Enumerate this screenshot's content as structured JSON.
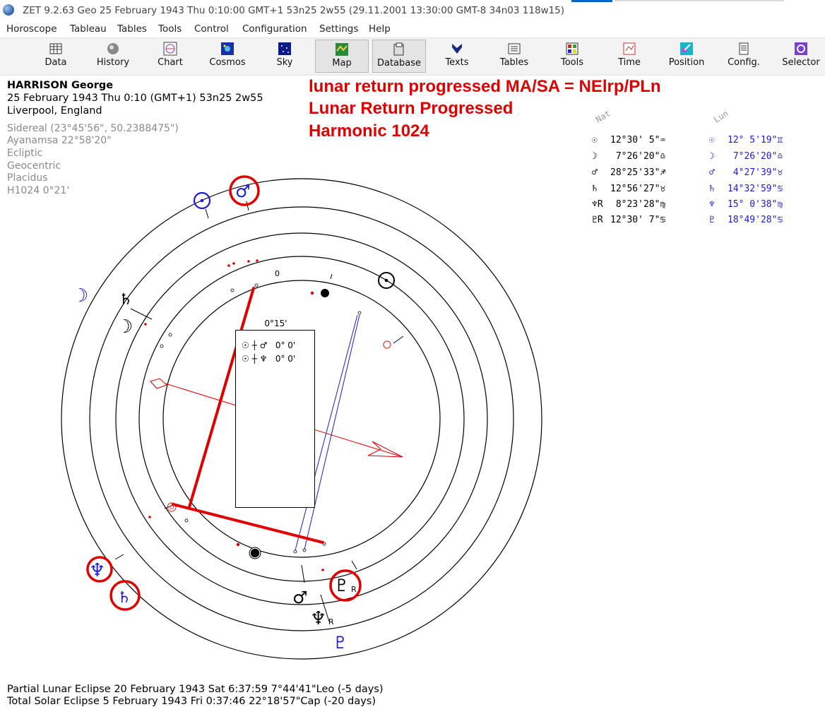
{
  "window": {
    "title": "ZET 9.2.63 Geo   25 February 1943  Thu   0:10:00 GMT+1 53n25  2w55   (29.11.2001  13:30:00 GMT-8 34n03 118w15)"
  },
  "menu": [
    "Horoscope",
    "Tableau",
    "Tables",
    "Tools",
    "Control",
    "Configuration",
    "Settings",
    "Help"
  ],
  "toolbar": [
    {
      "label": "Data",
      "icon": "data-grid-icon"
    },
    {
      "label": "History",
      "icon": "history-icon"
    },
    {
      "label": "Chart",
      "icon": "chart-wheel-icon"
    },
    {
      "label": "Cosmos",
      "icon": "cosmos-icon"
    },
    {
      "label": "Sky",
      "icon": "sky-icon"
    },
    {
      "label": "Map",
      "icon": "map-icon",
      "pressed": true
    },
    {
      "label": "Database",
      "icon": "database-icon",
      "pressed": true
    },
    {
      "label": "Texts",
      "icon": "texts-icon"
    },
    {
      "label": "Tables",
      "icon": "tables-icon"
    },
    {
      "label": "Tools",
      "icon": "tools-icon"
    },
    {
      "label": "Time",
      "icon": "time-icon"
    },
    {
      "label": "Position",
      "icon": "position-icon"
    },
    {
      "label": "Config.",
      "icon": "config-icon"
    },
    {
      "label": "Selector",
      "icon": "selector-icon"
    }
  ],
  "person": {
    "name": "HARRISON George",
    "birth": "25 February 1943  Thu   0:10 (GMT+1) 53n25  2w55",
    "place": "Liverpool, England"
  },
  "settings_lines": [
    "Sidereal (23°45'56\", 50.2388475\")",
    "Ayanamsa 22°58'20\"",
    "Ecliptic",
    "Geocentric",
    "Placidus",
    "H1024   0°21'"
  ],
  "annotation": {
    "line1": "lunar return progressed MA/SA = NElrp/PLn",
    "line2": "Lunar Return Progressed",
    "line3": "Harmonic 1024"
  },
  "positions_table": {
    "header_natal": "Nat",
    "header_lunar": "Lun",
    "rows": [
      {
        "nat_glyph": "☉",
        "nat_pos": "12°30' 5\"♒",
        "lun_glyph": "☉",
        "lun_pos": "12° 5'19\"♊"
      },
      {
        "nat_glyph": "☽",
        "nat_pos": " 7°26'20\"♎",
        "lun_glyph": "☽",
        "lun_pos": " 7°26'20\"♎"
      },
      {
        "nat_glyph": "♂",
        "nat_pos": "28°25'33\"♐",
        "lun_glyph": "♂",
        "lun_pos": " 4°27'39\"♉"
      },
      {
        "nat_glyph": "♄",
        "nat_pos": "12°56'27\"♉",
        "lun_glyph": "♄",
        "lun_pos": "14°32'59\"♋"
      },
      {
        "nat_glyph": "♆R",
        "nat_pos": " 8°23'28\"♍",
        "lun_glyph": "♆",
        "lun_pos": "15° 0'38\"♍"
      },
      {
        "nat_glyph": "♇R",
        "nat_pos": "12°30' 7\"♋",
        "lun_glyph": "♇",
        "lun_pos": "18°49'28\"♋"
      }
    ]
  },
  "aspect_box": {
    "header": "0°15'",
    "rows": [
      {
        "glyphs": "☉ ┼ ♂",
        "value": "0° 0'"
      },
      {
        "glyphs": "☉ ┼ ♆",
        "value": "0° 0'"
      }
    ]
  },
  "wheel_labels": {
    "zero_mark": "0",
    "retro": "R"
  },
  "footer": [
    "Partial Lunar Eclipse 20 February 1943 Sat  6:37:59  7°44'41\"Leo (-5 days)",
    "Total Solar Eclipse 5 February 1943 Fri  0:37:46 22°18'57\"Cap (-20 days)"
  ],
  "colors": {
    "annotation_red": "#e00000",
    "lunar_blue": "#1a1adb",
    "natal_black": "#000000"
  }
}
